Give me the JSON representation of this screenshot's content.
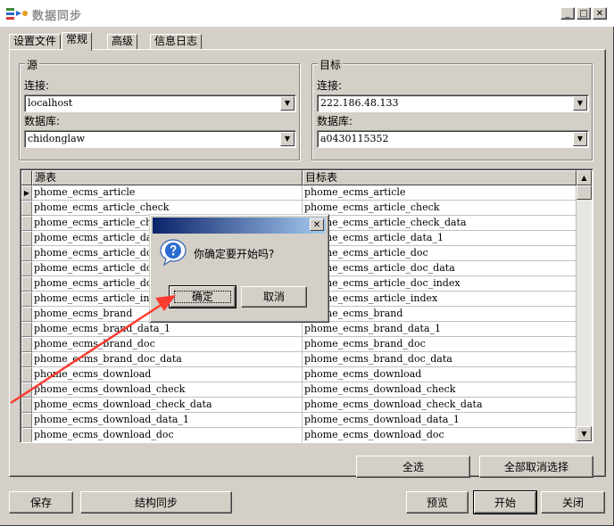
{
  "window": {
    "title": "数据同步"
  },
  "tabs": [
    {
      "label": "设置文件"
    },
    {
      "label": "常规"
    },
    {
      "label": "高级"
    },
    {
      "label": "信息日志"
    }
  ],
  "source": {
    "title": "源",
    "connection_label": "连接:",
    "connection_value": "localhost",
    "database_label": "数据库:",
    "database_value": "chidonglaw"
  },
  "target": {
    "title": "目标",
    "connection_label": "连接:",
    "connection_value": "222.186.48.133",
    "database_label": "数据库:",
    "database_value": "a0430115352"
  },
  "grid": {
    "headers": [
      "源表",
      "目标表"
    ],
    "rows": [
      [
        "phome_ecms_article",
        "phome_ecms_article"
      ],
      [
        "phome_ecms_article_check",
        "phome_ecms_article_check"
      ],
      [
        "phome_ecms_article_check_data",
        "phome_ecms_article_check_data"
      ],
      [
        "phome_ecms_article_data_1",
        "phome_ecms_article_data_1"
      ],
      [
        "phome_ecms_article_doc",
        "phome_ecms_article_doc"
      ],
      [
        "phome_ecms_article_doc_data",
        "phome_ecms_article_doc_data"
      ],
      [
        "phome_ecms_article_doc_index",
        "phome_ecms_article_doc_index"
      ],
      [
        "phome_ecms_article_index",
        "phome_ecms_article_index"
      ],
      [
        "phome_ecms_brand",
        "phome_ecms_brand"
      ],
      [
        "phome_ecms_brand_data_1",
        "phome_ecms_brand_data_1"
      ],
      [
        "phome_ecms_brand_doc",
        "phome_ecms_brand_doc"
      ],
      [
        "phome_ecms_brand_doc_data",
        "phome_ecms_brand_doc_data"
      ],
      [
        "phome_ecms_download",
        "phome_ecms_download"
      ],
      [
        "phome_ecms_download_check",
        "phome_ecms_download_check"
      ],
      [
        "phome_ecms_download_check_data",
        "phome_ecms_download_check_data"
      ],
      [
        "phome_ecms_download_data_1",
        "phome_ecms_download_data_1"
      ],
      [
        "phome_ecms_download_doc",
        "phome_ecms_download_doc"
      ]
    ]
  },
  "buttons": {
    "select_all": "全选",
    "deselect_all": "全部取消选择",
    "save": "保存",
    "structure_sync": "结构同步",
    "preview": "预览",
    "start": "开始",
    "close": "关闭"
  },
  "dialog": {
    "message": "你确定要开始吗?",
    "ok": "确定",
    "cancel": "取消"
  },
  "colors": {
    "window_bg": "#d4d0c8",
    "dialog_title_start": "#0a246a",
    "dialog_title_end": "#a6caf0",
    "annotation_arrow": "#ff3b30"
  }
}
